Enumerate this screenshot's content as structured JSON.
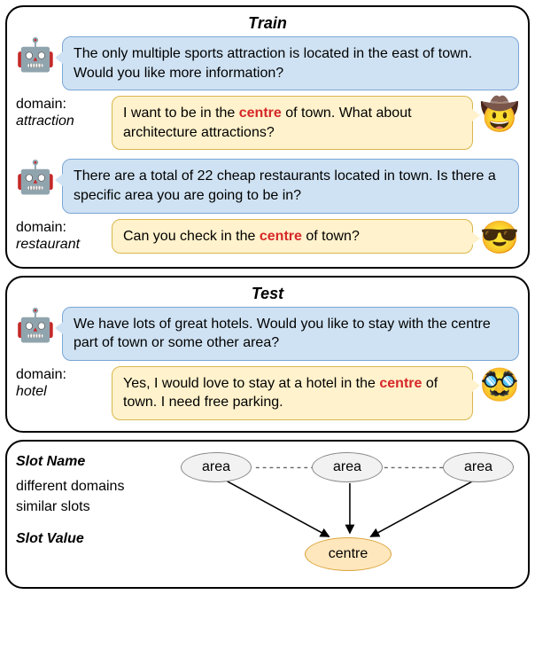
{
  "sections": {
    "train": {
      "title": "Train"
    },
    "test": {
      "title": "Test"
    }
  },
  "turns": {
    "train_bot_1": "The only multiple sports attraction is located in the east of town. Would you like more information?",
    "train_user_1_pre": "I want to be in the ",
    "train_user_1_hl": "centre",
    "train_user_1_post": " of town. What about architecture attractions?",
    "train_bot_2": "There are a total of 22 cheap restaurants located in town. Is there a specific area you are going to be in?",
    "train_user_2_pre": "Can you check in the ",
    "train_user_2_hl": "centre",
    "train_user_2_post": " of town?",
    "test_bot_1": "We have lots of great hotels.  Would you like to stay with the centre part of town or some other area?",
    "test_user_1_pre": "Yes, I would love to stay at a hotel in the ",
    "test_user_1_hl": "centre",
    "test_user_1_post": " of town.  I need free parking."
  },
  "domains": {
    "label": "domain:",
    "attraction": "attraction",
    "restaurant": "restaurant",
    "hotel": "hotel"
  },
  "avatars": {
    "bot": "🤖",
    "user1": "🤠",
    "user2": "😎",
    "user3": "🥸"
  },
  "slots": {
    "slot_name_heading": "Slot Name",
    "diff_domains": "different domains",
    "sim_slots": "similar slots",
    "slot_value_heading": "Slot Value",
    "area": "area",
    "centre": "centre"
  }
}
